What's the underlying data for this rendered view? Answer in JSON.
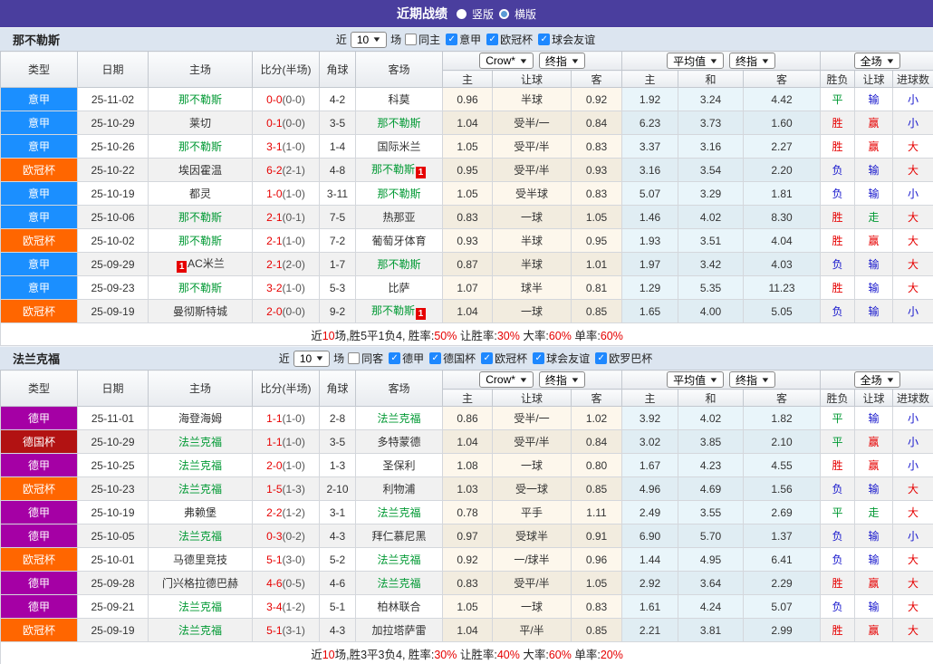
{
  "topbar": {
    "title": "近期战绩",
    "options": [
      {
        "label": "竖版",
        "selected": true
      },
      {
        "label": "横版",
        "selected": false
      }
    ]
  },
  "table_header": {
    "left_cols": [
      "类型",
      "日期",
      "主场",
      "比分(半场)",
      "角球",
      "客场"
    ],
    "odds_select_a": "Crow*",
    "odds_select_b": "终指",
    "odds_cols": [
      "主",
      "让球",
      "客"
    ],
    "avg_select_a": "平均值",
    "avg_select_b": "终指",
    "avg_cols": [
      "主",
      "和",
      "客"
    ],
    "scope_select": "全场",
    "result_cols": [
      "胜负",
      "让球",
      "进球数"
    ]
  },
  "colors": {
    "serie_a": "#1b8fff",
    "ucl": "#ff6600",
    "bundesliga": "#a500a5",
    "dfb": "#b21212",
    "result": {
      "r": "#e60000",
      "g": "#009933",
      "b": "#1515cc"
    }
  },
  "sections": [
    {
      "team": "那不勒斯",
      "filter": {
        "near_label": "近",
        "count": "10",
        "games_label": "场",
        "venue": {
          "label": "同主",
          "checked": false
        },
        "leagues": [
          {
            "label": "意甲",
            "checked": true
          },
          {
            "label": "欧冠杯",
            "checked": true
          },
          {
            "label": "球会友谊",
            "checked": true
          }
        ]
      },
      "rows": [
        {
          "type": "意甲",
          "type_key": "serie_a",
          "date": "25-11-02",
          "home": "那不勒斯",
          "home_self": true,
          "home_card": "",
          "home_card_pos": "",
          "score": "0-0",
          "half": "(0-0)",
          "corner": "4-2",
          "away": "科莫",
          "away_self": false,
          "away_card": "",
          "o_home": "0.96",
          "o_line": "半球",
          "o_away": "0.92",
          "avg_home": "1.92",
          "avg_draw": "3.24",
          "avg_away": "4.42",
          "res": [
            {
              "t": "平",
              "c": "g"
            },
            {
              "t": "输",
              "c": "b"
            },
            {
              "t": "小",
              "c": "b"
            }
          ]
        },
        {
          "type": "意甲",
          "type_key": "serie_a",
          "date": "25-10-29",
          "home": "莱切",
          "home_self": false,
          "home_card": "",
          "home_card_pos": "",
          "score": "0-1",
          "half": "(0-0)",
          "corner": "3-5",
          "away": "那不勒斯",
          "away_self": true,
          "away_card": "",
          "o_home": "1.04",
          "o_line": "受半/一",
          "o_away": "0.84",
          "avg_home": "6.23",
          "avg_draw": "3.73",
          "avg_away": "1.60",
          "res": [
            {
              "t": "胜",
              "c": "r"
            },
            {
              "t": "赢",
              "c": "r"
            },
            {
              "t": "小",
              "c": "b"
            }
          ]
        },
        {
          "type": "意甲",
          "type_key": "serie_a",
          "date": "25-10-26",
          "home": "那不勒斯",
          "home_self": true,
          "home_card": "",
          "home_card_pos": "",
          "score": "3-1",
          "half": "(1-0)",
          "corner": "1-4",
          "away": "国际米兰",
          "away_self": false,
          "away_card": "",
          "o_home": "1.05",
          "o_line": "受平/半",
          "o_away": "0.83",
          "avg_home": "3.37",
          "avg_draw": "3.16",
          "avg_away": "2.27",
          "res": [
            {
              "t": "胜",
              "c": "r"
            },
            {
              "t": "赢",
              "c": "r"
            },
            {
              "t": "大",
              "c": "r"
            }
          ]
        },
        {
          "type": "欧冠杯",
          "type_key": "ucl",
          "date": "25-10-22",
          "home": "埃因霍温",
          "home_self": false,
          "home_card": "",
          "home_card_pos": "",
          "score": "6-2",
          "half": "(2-1)",
          "corner": "4-8",
          "away": "那不勒斯",
          "away_self": true,
          "away_card": "1",
          "o_home": "0.95",
          "o_line": "受平/半",
          "o_away": "0.93",
          "avg_home": "3.16",
          "avg_draw": "3.54",
          "avg_away": "2.20",
          "res": [
            {
              "t": "负",
              "c": "b"
            },
            {
              "t": "输",
              "c": "b"
            },
            {
              "t": "大",
              "c": "r"
            }
          ]
        },
        {
          "type": "意甲",
          "type_key": "serie_a",
          "date": "25-10-19",
          "home": "都灵",
          "home_self": false,
          "home_card": "",
          "home_card_pos": "",
          "score": "1-0",
          "half": "(1-0)",
          "corner": "3-11",
          "away": "那不勒斯",
          "away_self": true,
          "away_card": "",
          "o_home": "1.05",
          "o_line": "受半球",
          "o_away": "0.83",
          "avg_home": "5.07",
          "avg_draw": "3.29",
          "avg_away": "1.81",
          "res": [
            {
              "t": "负",
              "c": "b"
            },
            {
              "t": "输",
              "c": "b"
            },
            {
              "t": "小",
              "c": "b"
            }
          ]
        },
        {
          "type": "意甲",
          "type_key": "serie_a",
          "date": "25-10-06",
          "home": "那不勒斯",
          "home_self": true,
          "home_card": "",
          "home_card_pos": "",
          "score": "2-1",
          "half": "(0-1)",
          "corner": "7-5",
          "away": "热那亚",
          "away_self": false,
          "away_card": "",
          "o_home": "0.83",
          "o_line": "一球",
          "o_away": "1.05",
          "avg_home": "1.46",
          "avg_draw": "4.02",
          "avg_away": "8.30",
          "res": [
            {
              "t": "胜",
              "c": "r"
            },
            {
              "t": "走",
              "c": "g"
            },
            {
              "t": "大",
              "c": "r"
            }
          ]
        },
        {
          "type": "欧冠杯",
          "type_key": "ucl",
          "date": "25-10-02",
          "home": "那不勒斯",
          "home_self": true,
          "home_card": "",
          "home_card_pos": "",
          "score": "2-1",
          "half": "(1-0)",
          "corner": "7-2",
          "away": "葡萄牙体育",
          "away_self": false,
          "away_card": "",
          "o_home": "0.93",
          "o_line": "半球",
          "o_away": "0.95",
          "avg_home": "1.93",
          "avg_draw": "3.51",
          "avg_away": "4.04",
          "res": [
            {
              "t": "胜",
              "c": "r"
            },
            {
              "t": "赢",
              "c": "r"
            },
            {
              "t": "大",
              "c": "r"
            }
          ]
        },
        {
          "type": "意甲",
          "type_key": "serie_a",
          "date": "25-09-29",
          "home": "AC米兰",
          "home_self": false,
          "home_card": "1",
          "home_card_pos": "pre",
          "score": "2-1",
          "half": "(2-0)",
          "corner": "1-7",
          "away": "那不勒斯",
          "away_self": true,
          "away_card": "",
          "o_home": "0.87",
          "o_line": "半球",
          "o_away": "1.01",
          "avg_home": "1.97",
          "avg_draw": "3.42",
          "avg_away": "4.03",
          "res": [
            {
              "t": "负",
              "c": "b"
            },
            {
              "t": "输",
              "c": "b"
            },
            {
              "t": "大",
              "c": "r"
            }
          ]
        },
        {
          "type": "意甲",
          "type_key": "serie_a",
          "date": "25-09-23",
          "home": "那不勒斯",
          "home_self": true,
          "home_card": "",
          "home_card_pos": "",
          "score": "3-2",
          "half": "(1-0)",
          "corner": "5-3",
          "away": "比萨",
          "away_self": false,
          "away_card": "",
          "o_home": "1.07",
          "o_line": "球半",
          "o_away": "0.81",
          "avg_home": "1.29",
          "avg_draw": "5.35",
          "avg_away": "11.23",
          "res": [
            {
              "t": "胜",
              "c": "r"
            },
            {
              "t": "输",
              "c": "b"
            },
            {
              "t": "大",
              "c": "r"
            }
          ]
        },
        {
          "type": "欧冠杯",
          "type_key": "ucl",
          "date": "25-09-19",
          "home": "曼彻斯特城",
          "home_self": false,
          "home_card": "",
          "home_card_pos": "",
          "score": "2-0",
          "half": "(0-0)",
          "corner": "9-2",
          "away": "那不勒斯",
          "away_self": true,
          "away_card": "1",
          "o_home": "1.04",
          "o_line": "一球",
          "o_away": "0.85",
          "avg_home": "1.65",
          "avg_draw": "4.00",
          "avg_away": "5.05",
          "res": [
            {
              "t": "负",
              "c": "b"
            },
            {
              "t": "输",
              "c": "b"
            },
            {
              "t": "小",
              "c": "b"
            }
          ]
        }
      ],
      "summary": [
        [
          "近",
          "k"
        ],
        [
          "10",
          "r"
        ],
        [
          "场,胜5平1负4, 胜率:",
          "k"
        ],
        [
          "50%",
          "r"
        ],
        [
          " 让胜率:",
          "k"
        ],
        [
          "30%",
          "r"
        ],
        [
          " 大率:",
          "k"
        ],
        [
          "60%",
          "r"
        ],
        [
          " 单率:",
          "k"
        ],
        [
          "60%",
          "r"
        ]
      ]
    },
    {
      "team": "法兰克福",
      "filter": {
        "near_label": "近",
        "count": "10",
        "games_label": "场",
        "venue": {
          "label": "同客",
          "checked": false
        },
        "leagues": [
          {
            "label": "德甲",
            "checked": true
          },
          {
            "label": "德国杯",
            "checked": true
          },
          {
            "label": "欧冠杯",
            "checked": true
          },
          {
            "label": "球会友谊",
            "checked": true
          },
          {
            "label": "欧罗巴杯",
            "checked": true
          }
        ]
      },
      "rows": [
        {
          "type": "德甲",
          "type_key": "bundesliga",
          "date": "25-11-01",
          "home": "海登海姆",
          "home_self": false,
          "home_card": "",
          "home_card_pos": "",
          "score": "1-1",
          "half": "(1-0)",
          "corner": "2-8",
          "away": "法兰克福",
          "away_self": true,
          "away_card": "",
          "o_home": "0.86",
          "o_line": "受半/一",
          "o_away": "1.02",
          "avg_home": "3.92",
          "avg_draw": "4.02",
          "avg_away": "1.82",
          "res": [
            {
              "t": "平",
              "c": "g"
            },
            {
              "t": "输",
              "c": "b"
            },
            {
              "t": "小",
              "c": "b"
            }
          ]
        },
        {
          "type": "德国杯",
          "type_key": "dfb",
          "date": "25-10-29",
          "home": "法兰克福",
          "home_self": true,
          "home_card": "",
          "home_card_pos": "",
          "score": "1-1",
          "half": "(1-0)",
          "corner": "3-5",
          "away": "多特蒙德",
          "away_self": false,
          "away_card": "",
          "o_home": "1.04",
          "o_line": "受平/半",
          "o_away": "0.84",
          "avg_home": "3.02",
          "avg_draw": "3.85",
          "avg_away": "2.10",
          "res": [
            {
              "t": "平",
              "c": "g"
            },
            {
              "t": "赢",
              "c": "r"
            },
            {
              "t": "小",
              "c": "b"
            }
          ]
        },
        {
          "type": "德甲",
          "type_key": "bundesliga",
          "date": "25-10-25",
          "home": "法兰克福",
          "home_self": true,
          "home_card": "",
          "home_card_pos": "",
          "score": "2-0",
          "half": "(1-0)",
          "corner": "1-3",
          "away": "圣保利",
          "away_self": false,
          "away_card": "",
          "o_home": "1.08",
          "o_line": "一球",
          "o_away": "0.80",
          "avg_home": "1.67",
          "avg_draw": "4.23",
          "avg_away": "4.55",
          "res": [
            {
              "t": "胜",
              "c": "r"
            },
            {
              "t": "赢",
              "c": "r"
            },
            {
              "t": "小",
              "c": "b"
            }
          ]
        },
        {
          "type": "欧冠杯",
          "type_key": "ucl",
          "date": "25-10-23",
          "home": "法兰克福",
          "home_self": true,
          "home_card": "",
          "home_card_pos": "",
          "score": "1-5",
          "half": "(1-3)",
          "corner": "2-10",
          "away": "利物浦",
          "away_self": false,
          "away_card": "",
          "o_home": "1.03",
          "o_line": "受一球",
          "o_away": "0.85",
          "avg_home": "4.96",
          "avg_draw": "4.69",
          "avg_away": "1.56",
          "res": [
            {
              "t": "负",
              "c": "b"
            },
            {
              "t": "输",
              "c": "b"
            },
            {
              "t": "大",
              "c": "r"
            }
          ]
        },
        {
          "type": "德甲",
          "type_key": "bundesliga",
          "date": "25-10-19",
          "home": "弗赖堡",
          "home_self": false,
          "home_card": "",
          "home_card_pos": "",
          "score": "2-2",
          "half": "(1-2)",
          "corner": "3-1",
          "away": "法兰克福",
          "away_self": true,
          "away_card": "",
          "o_home": "0.78",
          "o_line": "平手",
          "o_away": "1.11",
          "avg_home": "2.49",
          "avg_draw": "3.55",
          "avg_away": "2.69",
          "res": [
            {
              "t": "平",
              "c": "g"
            },
            {
              "t": "走",
              "c": "g"
            },
            {
              "t": "大",
              "c": "r"
            }
          ]
        },
        {
          "type": "德甲",
          "type_key": "bundesliga",
          "date": "25-10-05",
          "home": "法兰克福",
          "home_self": true,
          "home_card": "",
          "home_card_pos": "",
          "score": "0-3",
          "half": "(0-2)",
          "corner": "4-3",
          "away": "拜仁慕尼黑",
          "away_self": false,
          "away_card": "",
          "o_home": "0.97",
          "o_line": "受球半",
          "o_away": "0.91",
          "avg_home": "6.90",
          "avg_draw": "5.70",
          "avg_away": "1.37",
          "res": [
            {
              "t": "负",
              "c": "b"
            },
            {
              "t": "输",
              "c": "b"
            },
            {
              "t": "小",
              "c": "b"
            }
          ]
        },
        {
          "type": "欧冠杯",
          "type_key": "ucl",
          "date": "25-10-01",
          "home": "马德里竞技",
          "home_self": false,
          "home_card": "",
          "home_card_pos": "",
          "score": "5-1",
          "half": "(3-0)",
          "corner": "5-2",
          "away": "法兰克福",
          "away_self": true,
          "away_card": "",
          "o_home": "0.92",
          "o_line": "一/球半",
          "o_away": "0.96",
          "avg_home": "1.44",
          "avg_draw": "4.95",
          "avg_away": "6.41",
          "res": [
            {
              "t": "负",
              "c": "b"
            },
            {
              "t": "输",
              "c": "b"
            },
            {
              "t": "大",
              "c": "r"
            }
          ]
        },
        {
          "type": "德甲",
          "type_key": "bundesliga",
          "date": "25-09-28",
          "home": "门兴格拉德巴赫",
          "home_self": false,
          "home_card": "",
          "home_card_pos": "",
          "score": "4-6",
          "half": "(0-5)",
          "corner": "4-6",
          "away": "法兰克福",
          "away_self": true,
          "away_card": "",
          "o_home": "0.83",
          "o_line": "受平/半",
          "o_away": "1.05",
          "avg_home": "2.92",
          "avg_draw": "3.64",
          "avg_away": "2.29",
          "res": [
            {
              "t": "胜",
              "c": "r"
            },
            {
              "t": "赢",
              "c": "r"
            },
            {
              "t": "大",
              "c": "r"
            }
          ]
        },
        {
          "type": "德甲",
          "type_key": "bundesliga",
          "date": "25-09-21",
          "home": "法兰克福",
          "home_self": true,
          "home_card": "",
          "home_card_pos": "",
          "score": "3-4",
          "half": "(1-2)",
          "corner": "5-1",
          "away": "柏林联合",
          "away_self": false,
          "away_card": "",
          "o_home": "1.05",
          "o_line": "一球",
          "o_away": "0.83",
          "avg_home": "1.61",
          "avg_draw": "4.24",
          "avg_away": "5.07",
          "res": [
            {
              "t": "负",
              "c": "b"
            },
            {
              "t": "输",
              "c": "b"
            },
            {
              "t": "大",
              "c": "r"
            }
          ]
        },
        {
          "type": "欧冠杯",
          "type_key": "ucl",
          "date": "25-09-19",
          "home": "法兰克福",
          "home_self": true,
          "home_card": "",
          "home_card_pos": "",
          "score": "5-1",
          "half": "(3-1)",
          "corner": "4-3",
          "away": "加拉塔萨雷",
          "away_self": false,
          "away_card": "",
          "o_home": "1.04",
          "o_line": "平/半",
          "o_away": "0.85",
          "avg_home": "2.21",
          "avg_draw": "3.81",
          "avg_away": "2.99",
          "res": [
            {
              "t": "胜",
              "c": "r"
            },
            {
              "t": "赢",
              "c": "r"
            },
            {
              "t": "大",
              "c": "r"
            }
          ]
        }
      ],
      "summary": [
        [
          "近",
          "k"
        ],
        [
          "10",
          "r"
        ],
        [
          "场,胜3平3负4, 胜率:",
          "k"
        ],
        [
          "30%",
          "r"
        ],
        [
          " 让胜率:",
          "k"
        ],
        [
          "40%",
          "r"
        ],
        [
          " 大率:",
          "k"
        ],
        [
          "60%",
          "r"
        ],
        [
          " 单率:",
          "k"
        ],
        [
          "20%",
          "r"
        ]
      ]
    }
  ]
}
